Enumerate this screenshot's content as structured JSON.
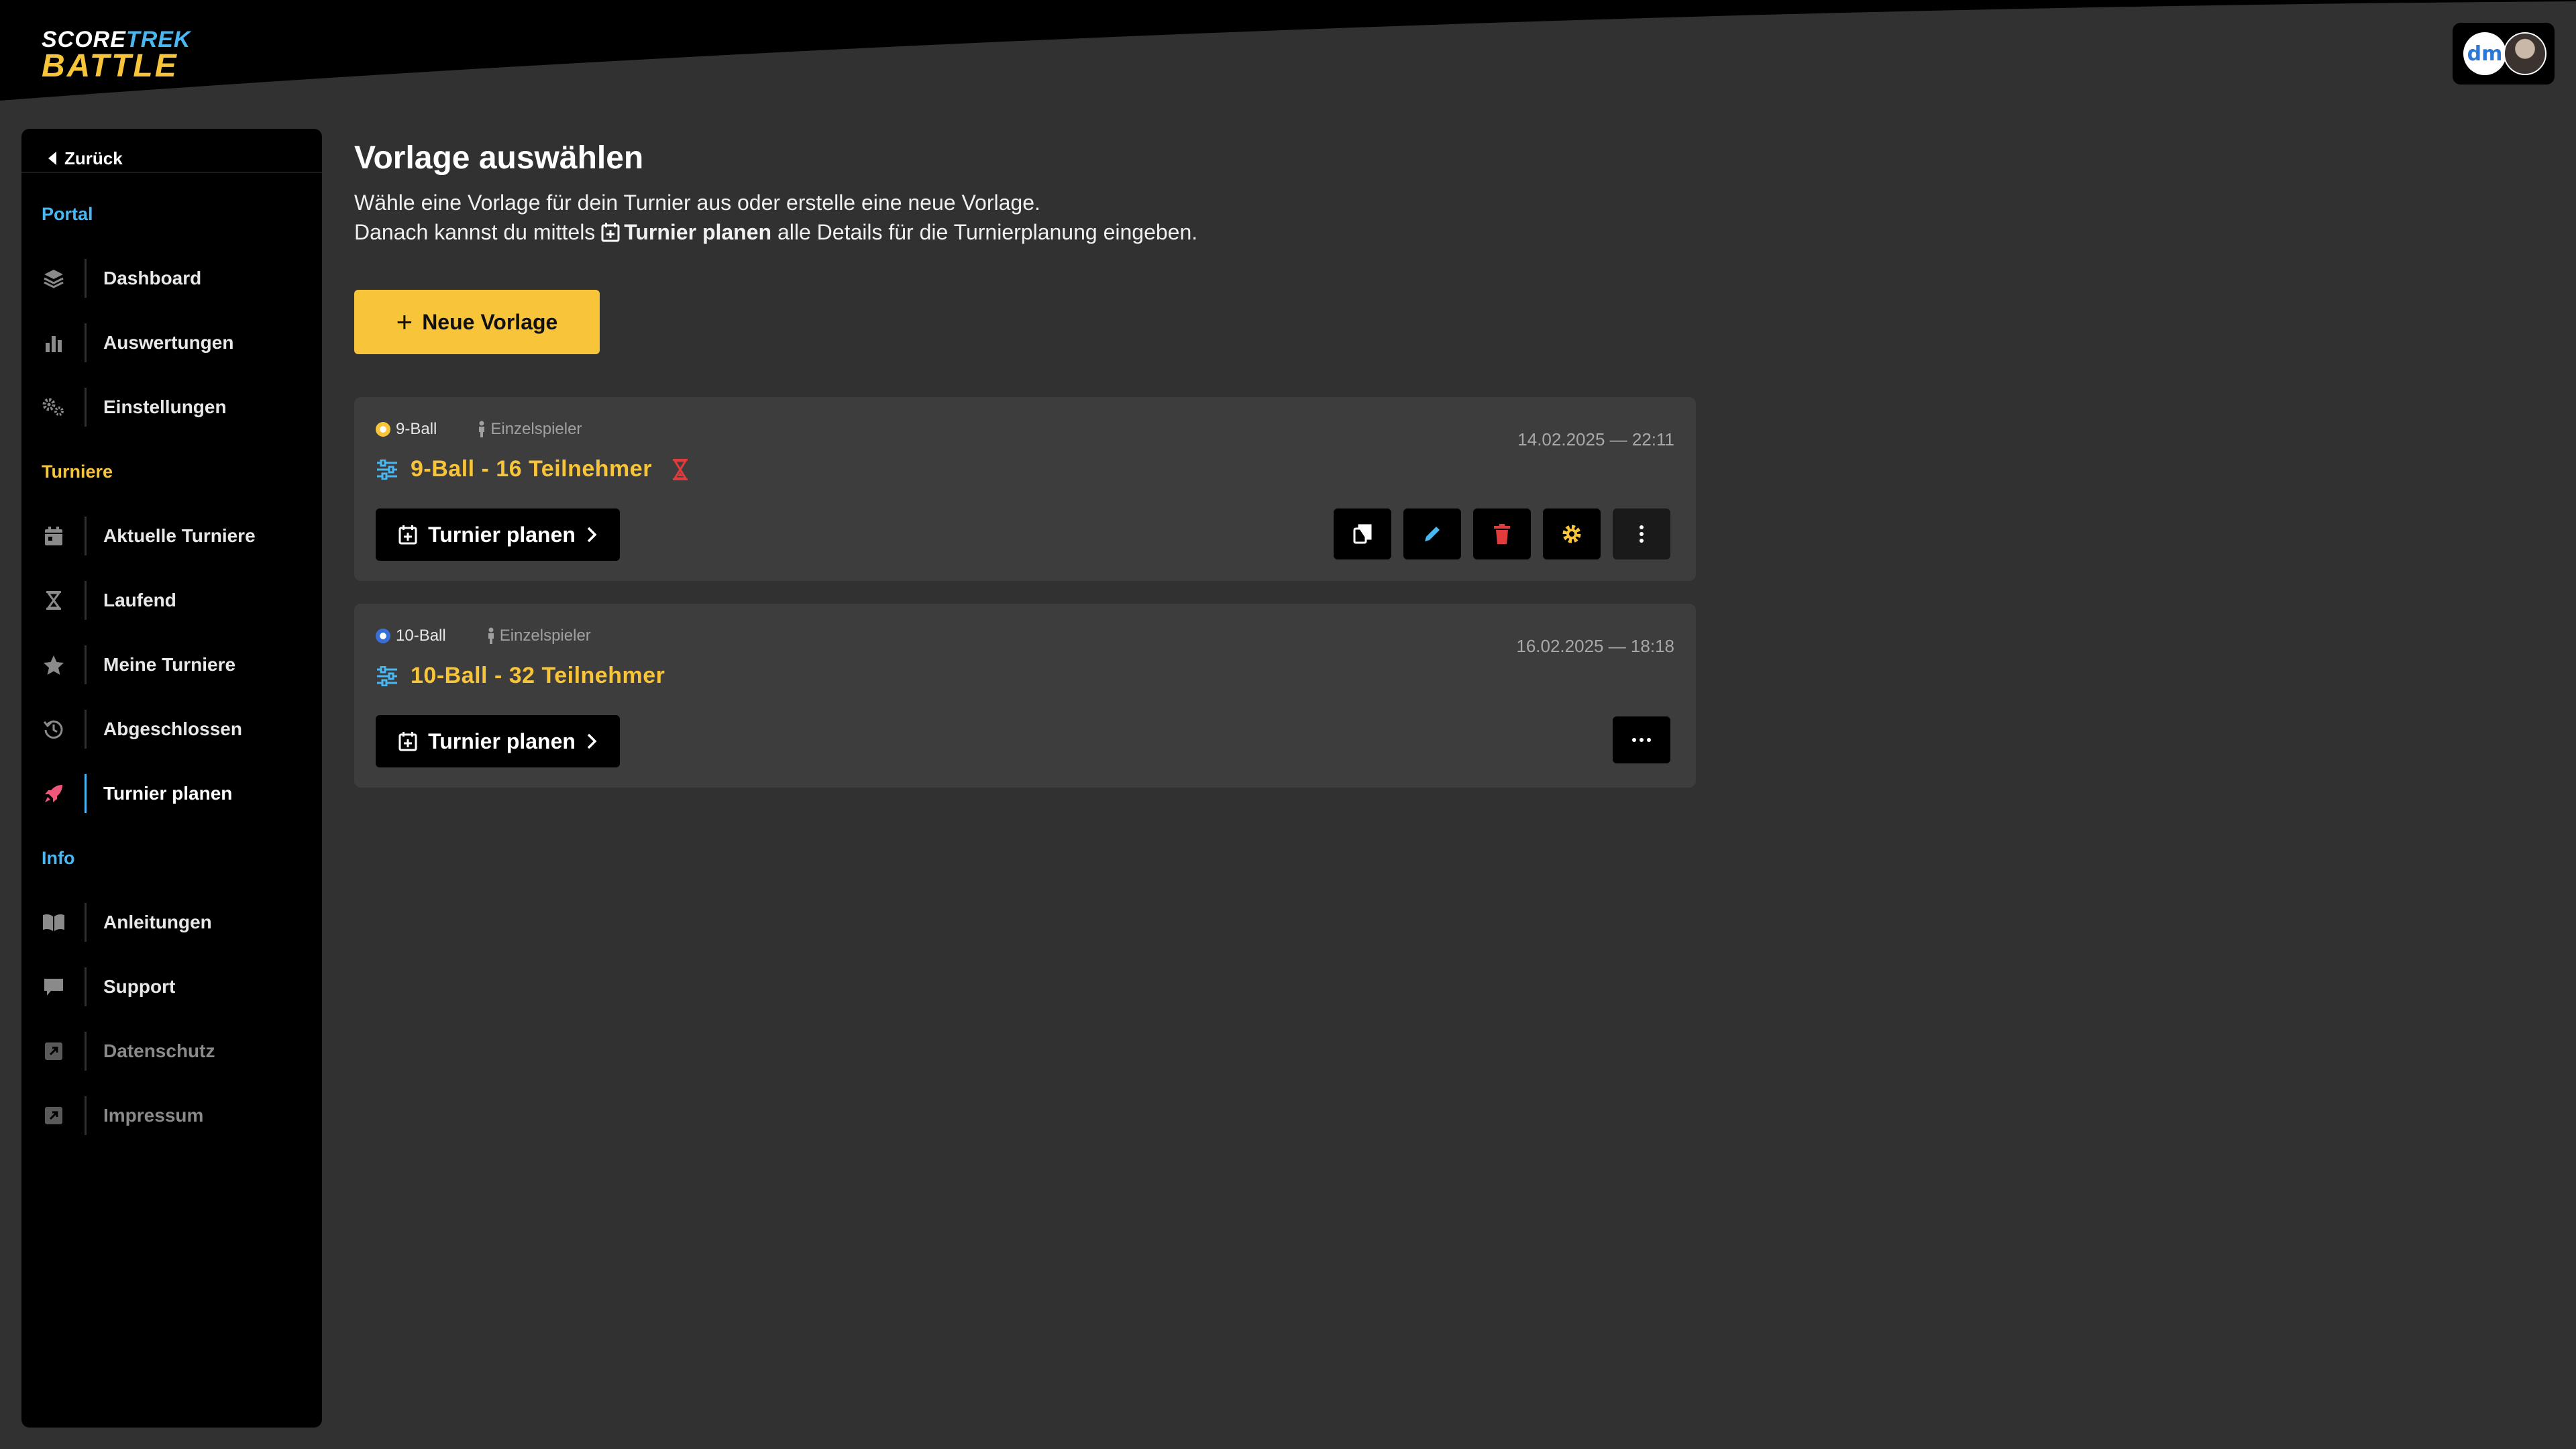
{
  "header": {
    "logo": {
      "line1_a": "SCORE",
      "line1_b": "TREK",
      "line2": "BATTLE"
    },
    "user": {
      "org_logo_text": "dm"
    }
  },
  "sidebar": {
    "back_label": "Zurück",
    "sections": {
      "portal": "Portal",
      "turniere": "Turniere",
      "info": "Info"
    },
    "items": [
      {
        "label": "Dashboard",
        "icon": "layers-icon"
      },
      {
        "label": "Auswertungen",
        "icon": "bar-chart-icon"
      },
      {
        "label": "Einstellungen",
        "icon": "gears-icon"
      },
      {
        "label": "Aktuelle Turniere",
        "icon": "calendar-icon"
      },
      {
        "label": "Laufend",
        "icon": "hourglass-icon"
      },
      {
        "label": "Meine Turniere",
        "icon": "star-icon"
      },
      {
        "label": "Abgeschlossen",
        "icon": "history-icon"
      },
      {
        "label": "Turnier planen",
        "icon": "rocket-icon",
        "active": true
      },
      {
        "label": "Anleitungen",
        "icon": "book-icon"
      },
      {
        "label": "Support",
        "icon": "comment-icon"
      },
      {
        "label": "Datenschutz",
        "icon": "external-link-icon"
      },
      {
        "label": "Impressum",
        "icon": "external-link-icon"
      }
    ]
  },
  "main": {
    "title": "Vorlage auswählen",
    "desc_line1": "Wähle eine Vorlage für dein Turnier aus oder erstelle eine neue Vorlage.",
    "desc_line2_pre": "Danach kannst du mittels",
    "desc_line2_bold": "Turnier planen",
    "desc_line2_post": "alle Details für die Turnierplanung eingeben.",
    "new_template_label": "Neue Vorlage",
    "templates": [
      {
        "game": "9-Ball",
        "mode": "Einzelspieler",
        "date": "14.02.2025 — 22:11",
        "name": "9-Ball - 16 Teilnehmer",
        "plan_label": "Turnier planen"
      },
      {
        "game": "10-Ball",
        "mode": "Einzelspieler",
        "date": "16.02.2025 — 18:18",
        "name": "10-Ball - 32 Teilnehmer",
        "plan_label": "Turnier planen"
      }
    ]
  },
  "colors": {
    "accent_yellow": "#f8c53a",
    "accent_blue": "#49b8f2",
    "danger_red": "#e23b3b",
    "background": "#313131",
    "card": "#3d3d3d"
  }
}
